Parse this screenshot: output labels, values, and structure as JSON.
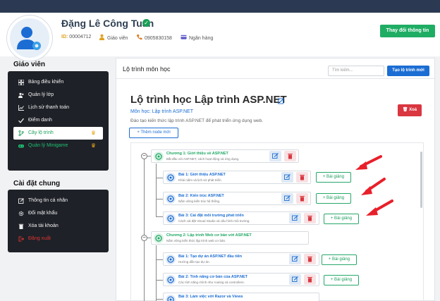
{
  "profile": {
    "name": "Đặng Lê Công Tuấn",
    "id_label": "ID:",
    "id_value": "00004712",
    "role": "Giáo viên",
    "phone": "0905830158",
    "bank": "Ngân hàng",
    "change_info_button": "Thay đổi thông tin"
  },
  "sidebar": {
    "section_teacher": "Giáo viên",
    "teacher_items": [
      {
        "label": "Bảng điều khiển",
        "icon": "dashboard-icon"
      },
      {
        "label": "Quản lý lớp",
        "icon": "people-icon"
      },
      {
        "label": "Lịch sử thanh toán",
        "icon": "chart-icon"
      },
      {
        "label": "Điểm danh",
        "icon": "check-icon"
      },
      {
        "label": "Cây lộ trình",
        "icon": "branch-icon",
        "active": true
      },
      {
        "label": "Quản lý Minigame",
        "icon": "gamepad-icon"
      }
    ],
    "section_settings": "Cài đặt chung",
    "settings_items": [
      {
        "label": "Thông tin cá nhân",
        "icon": "edit-icon"
      },
      {
        "label": "Đổi mật khẩu",
        "icon": "gear-icon"
      },
      {
        "label": "Xóa tài khoản",
        "icon": "trash-icon"
      },
      {
        "label": "Đăng xuất",
        "icon": "logout-icon"
      }
    ]
  },
  "main": {
    "header_title": "Lộ trình môn học",
    "search_placeholder": "Tìm kiếm...",
    "create_button": "Tạo lộ trình mới",
    "course_title": "Lộ trình học Lập trình ASP.NET",
    "course_subject": "Môn học: Lập trình ASP.NET",
    "course_desc": "Đào tạo kiến thức lập trình ASP.NET để phát triển ứng dụng web.",
    "delete_button": "Xoá",
    "add_node_button": "+ Thêm node mới",
    "add_lesson_label": "+ Bài giảng"
  },
  "tree": {
    "chapters": [
      {
        "title": "Chương 1: Giới thiệu về ASP.NET",
        "desc": "Bắt đầu với ASP.NET, cách hoạt động và ứng dụng.",
        "lessons": [
          {
            "title": "Bài 1: Giới thiệu ASP.NET",
            "desc": "Khái niệm và lịch sử phát triển."
          },
          {
            "title": "Bài 2: Kiến trúc ASP.NET",
            "desc": "Nắm vững kiến trúc hệ thống."
          },
          {
            "title": "Bài 3: Cài đặt môi trường phát triển",
            "desc": "Cách cài đặt Visual Studio và cấu hình môi trường."
          }
        ]
      },
      {
        "title": "Chương 2: Lập trình Web cơ bản với ASP.NET",
        "desc": "Nắm vững kiến thức lập trình web cơ bản.",
        "lessons": [
          {
            "title": "Bài 1: Tạo dự án ASP.NET đầu tiên",
            "desc": "Hướng dẫn tạo dự án."
          },
          {
            "title": "Bài 2: Tính năng cơ bản của ASP.NET",
            "desc": "Các tính năng chính như routing và controllers."
          },
          {
            "title": "Bài 3: Làm việc với Razor và Views",
            "desc": ""
          }
        ]
      }
    ]
  },
  "colors": {
    "accent_green": "#1fad64",
    "accent_blue": "#1b6dd3",
    "danger_red": "#d93640",
    "annotation_arrow": "#e8202a"
  }
}
